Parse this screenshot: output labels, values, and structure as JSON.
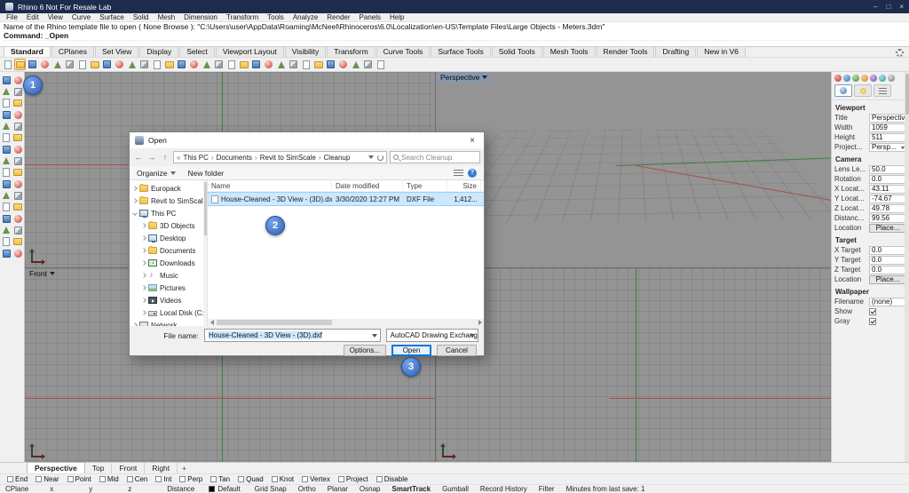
{
  "window": {
    "title": "Rhino 6 Not For Resale Lab"
  },
  "menu": {
    "items": [
      "File",
      "Edit",
      "View",
      "Curve",
      "Surface",
      "Solid",
      "Mesh",
      "Dimension",
      "Transform",
      "Tools",
      "Analyze",
      "Render",
      "Panels",
      "Help"
    ]
  },
  "command": {
    "line1": "Name of the Rhino template file to open ( None  Browse ): \"C:\\Users\\user\\AppData\\Roaming\\McNeel\\Rhinoceros\\6.0\\Localization\\en-US\\Template Files\\Large Objects - Meters.3dm\"",
    "line2": "Command: _Open"
  },
  "toolbar_tabs": {
    "active": "Standard",
    "items": [
      "Standard",
      "CPlanes",
      "Set View",
      "Display",
      "Select",
      "Viewport Layout",
      "Visibility",
      "Transform",
      "Curve Tools",
      "Surface Tools",
      "Solid Tools",
      "Mesh Tools",
      "Render Tools",
      "Drafting",
      "New in V6"
    ]
  },
  "toolbar_icons": [
    "new-file",
    "open-file",
    "save",
    "print",
    "cut",
    "copy-to-clipboard",
    "paste",
    "undo",
    "redo",
    "delete",
    "select-all",
    "zoom-extents",
    "zoom-window",
    "pan-view",
    "rotate-view",
    "named-views",
    "viewport-layout",
    "move",
    "copy-object",
    "rotate-object",
    "scale-object",
    "mirror-object",
    "join",
    "trim",
    "split",
    "group",
    "hide",
    "lock",
    "layers",
    "object-properties",
    "help"
  ],
  "left_toolbar_icons": [
    "selection",
    "move",
    "copy",
    "rotate",
    "scale",
    "mirror",
    "array",
    "orient",
    "trim",
    "split",
    "join",
    "explode",
    "fillet",
    "chamfer",
    "offset",
    "blend",
    "point",
    "polyline",
    "circle",
    "arc",
    "rectangle",
    "polygon",
    "ellipse",
    "curve",
    "text",
    "dimension",
    "surface",
    "loft",
    "extrude",
    "sweep",
    "boolean",
    "mesh"
  ],
  "viewports": {
    "perspective_label": "Perspective",
    "front_label": "Front",
    "tabs": [
      "Perspective",
      "Top",
      "Front",
      "Right"
    ],
    "active_tab": "Perspective",
    "new_tab_label": "+"
  },
  "properties": {
    "sections": [
      {
        "title": "Viewport",
        "rows": [
          {
            "label": "Title",
            "value": "Perspective",
            "type": "field"
          },
          {
            "label": "Width",
            "value": "1059",
            "type": "field"
          },
          {
            "label": "Height",
            "value": "511",
            "type": "field"
          },
          {
            "label": "Project...",
            "value": "Persp...",
            "type": "dropdown"
          }
        ]
      },
      {
        "title": "Camera",
        "rows": [
          {
            "label": "Lens Le...",
            "value": "50.0",
            "type": "field"
          },
          {
            "label": "Rotation",
            "value": "0.0",
            "type": "field"
          },
          {
            "label": "X Locat...",
            "value": "43.11",
            "type": "field"
          },
          {
            "label": "Y Locat...",
            "value": "-74.67",
            "type": "field"
          },
          {
            "label": "Z Locat...",
            "value": "49.78",
            "type": "field"
          },
          {
            "label": "Distanc...",
            "value": "99.56",
            "type": "field"
          },
          {
            "label": "Location",
            "value": "Place...",
            "type": "button"
          }
        ]
      },
      {
        "title": "Target",
        "rows": [
          {
            "label": "X Target",
            "value": "0.0",
            "type": "field"
          },
          {
            "label": "Y Target",
            "value": "0.0",
            "type": "field"
          },
          {
            "label": "Z Target",
            "value": "0.0",
            "type": "field"
          },
          {
            "label": "Location",
            "value": "Place...",
            "type": "button"
          }
        ]
      },
      {
        "title": "Wallpaper",
        "rows": [
          {
            "label": "Filename",
            "value": "(none)",
            "type": "field"
          },
          {
            "label": "Show",
            "value": "checked",
            "type": "checkbox"
          },
          {
            "label": "Gray",
            "value": "checked",
            "type": "checkbox"
          }
        ]
      }
    ]
  },
  "dialog": {
    "title": "Open",
    "breadcrumb": {
      "overflow": "«",
      "segments": [
        "This PC",
        "Documents",
        "Revit to SimScale",
        "Cleanup"
      ]
    },
    "search_placeholder": "Search Cleanup",
    "toolbar": {
      "organize": "Organize",
      "new_folder": "New folder"
    },
    "nav": [
      {
        "label": "Europack",
        "icon": "folder",
        "chev": "r",
        "indent": 0
      },
      {
        "label": "Revit to SimScale",
        "icon": "folder",
        "chev": "r",
        "indent": 0
      },
      {
        "label": "This PC",
        "icon": "pc",
        "chev": "d",
        "indent": 0
      },
      {
        "label": "3D Objects",
        "icon": "folder",
        "chev": "r",
        "indent": 1
      },
      {
        "label": "Desktop",
        "icon": "pc",
        "chev": "r",
        "indent": 1
      },
      {
        "label": "Documents",
        "icon": "folder",
        "chev": "r",
        "indent": 1
      },
      {
        "label": "Downloads",
        "icon": "download",
        "chev": "r",
        "indent": 1
      },
      {
        "label": "Music",
        "icon": "music",
        "chev": "r",
        "indent": 1
      },
      {
        "label": "Pictures",
        "icon": "picture",
        "chev": "r",
        "indent": 1
      },
      {
        "label": "Videos",
        "icon": "video",
        "chev": "r",
        "indent": 1
      },
      {
        "label": "Local Disk (C:)",
        "icon": "drive",
        "chev": "r",
        "indent": 1
      },
      {
        "label": "Network",
        "icon": "net",
        "chev": "r",
        "indent": 0
      }
    ],
    "columns": [
      "Name",
      "Date modified",
      "Type",
      "Size"
    ],
    "files": [
      {
        "name": "House-Cleaned - 3D View - (3D).dxf",
        "date_modified": "3/30/2020 12:27 PM",
        "type": "DXF File",
        "size": "1,412...",
        "selected": true
      }
    ],
    "file_name_label": "File name:",
    "file_name_value": "House-Cleaned - 3D View - (3D).dxf",
    "file_type_value": "AutoCAD Drawing Exchange (*...",
    "buttons": {
      "options": "Options...",
      "open": "Open",
      "cancel": "Cancel"
    },
    "help_label": "?"
  },
  "status": {
    "osnap": [
      "End",
      "Near",
      "Point",
      "Mid",
      "Cen",
      "Int",
      "Perp",
      "Tan",
      "Quad",
      "Knot",
      "Vertex",
      "Project",
      "Disable"
    ],
    "cplane_label": "CPlane",
    "coord_labels": [
      "x",
      "y",
      "z"
    ],
    "distance_label": "Distance",
    "layer_name": "Default",
    "toggles": [
      {
        "label": "Grid Snap",
        "bold": false
      },
      {
        "label": "Ortho",
        "bold": false
      },
      {
        "label": "Planar",
        "bold": false
      },
      {
        "label": "Osnap",
        "bold": false
      },
      {
        "label": "SmartTrack",
        "bold": true
      },
      {
        "label": "Gumball",
        "bold": false
      },
      {
        "label": "Record History",
        "bold": false
      },
      {
        "label": "Filter",
        "bold": false
      }
    ],
    "autosave_note": "Minutes from last save: 1"
  },
  "annotations": {
    "step1": "1",
    "step2": "2",
    "step3": "3"
  },
  "colors": {
    "accent": "#2d5fb3",
    "selection": "#cce8ff",
    "open_button_focus": "#0078d7",
    "titlebar": "#1d2b4d",
    "viewport_bg": "#949494"
  }
}
